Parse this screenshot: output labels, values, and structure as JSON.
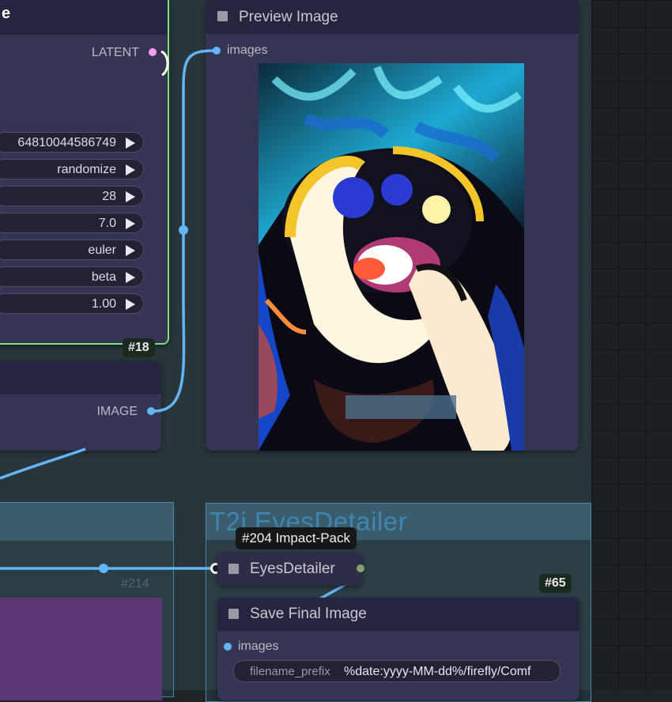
{
  "sampler_node": {
    "title_fragment": "e",
    "output_label": "LATENT",
    "widgets": [
      {
        "value": "64810044586749"
      },
      {
        "value": "randomize"
      },
      {
        "value": "28"
      },
      {
        "value": "7.0"
      },
      {
        "value": "euler"
      },
      {
        "value": "beta"
      },
      {
        "value": "1.00"
      }
    ],
    "badge": "#18"
  },
  "decode_node": {
    "output_label": "IMAGE"
  },
  "preview_node": {
    "title": "Preview Image",
    "input_label": "images"
  },
  "group_left": {
    "badge": "#214"
  },
  "group_right": {
    "title": "T2i EyesDetailer"
  },
  "eyes_node": {
    "title": "EyesDetailer",
    "tooltip": "#204 Impact-Pack"
  },
  "save_node": {
    "title": "Save Final Image",
    "input_label": "images",
    "badge": "#65",
    "filename_label": "filename_prefix",
    "filename_value": "%date:yyyy-MM-dd%/firefly/Comf"
  },
  "colors": {
    "wire_image": "#64b5f6",
    "latent_dot": "#ff9cf9",
    "selected_outline": "#7ee07e",
    "group_border": "#4a87a8"
  },
  "icons": [
    "node-collapse-icon",
    "slot-dot-icon",
    "play-arrow-icon"
  ]
}
